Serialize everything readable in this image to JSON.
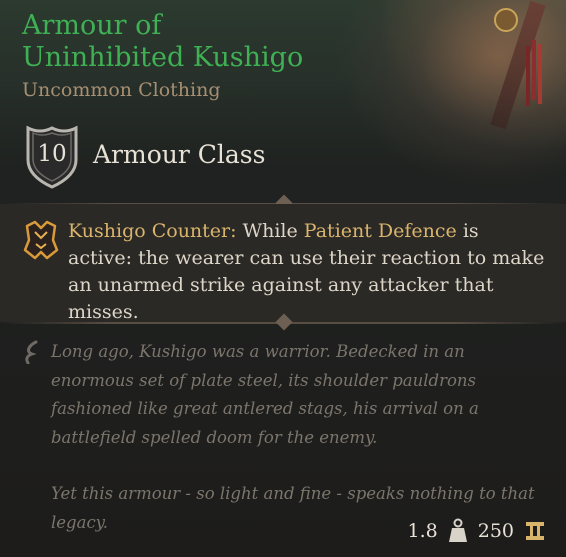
{
  "item": {
    "name": "Armour of Uninhibited Kushigo",
    "rarity_type": "Uncommon Clothing",
    "rarity_color": "#3fb053"
  },
  "armour": {
    "value": "10",
    "label": "Armour Class"
  },
  "passive": {
    "name": "Kushigo Counter:",
    "text_before": " While ",
    "highlight": "Patient Defence",
    "text_after": " is active: the wearer can use their reaction to make an unarmed strike against any attacker that misses.",
    "icon": "kushigo-counter-icon"
  },
  "lore": {
    "paragraphs": [
      "Long ago, Kushigo was a warrior. Bedecked in an enormous set of plate steel, its shoulder pauldrons fashioned like great antlered stags, his arrival on a battlefield spelled doom for the enemy.",
      "Yet this armour - so light and fine - speaks nothing to that legacy."
    ],
    "icon": "quill-icon"
  },
  "footer": {
    "weight": "1.8",
    "weight_icon": "weight-icon",
    "value": "250",
    "value_icon": "gold-icon"
  }
}
